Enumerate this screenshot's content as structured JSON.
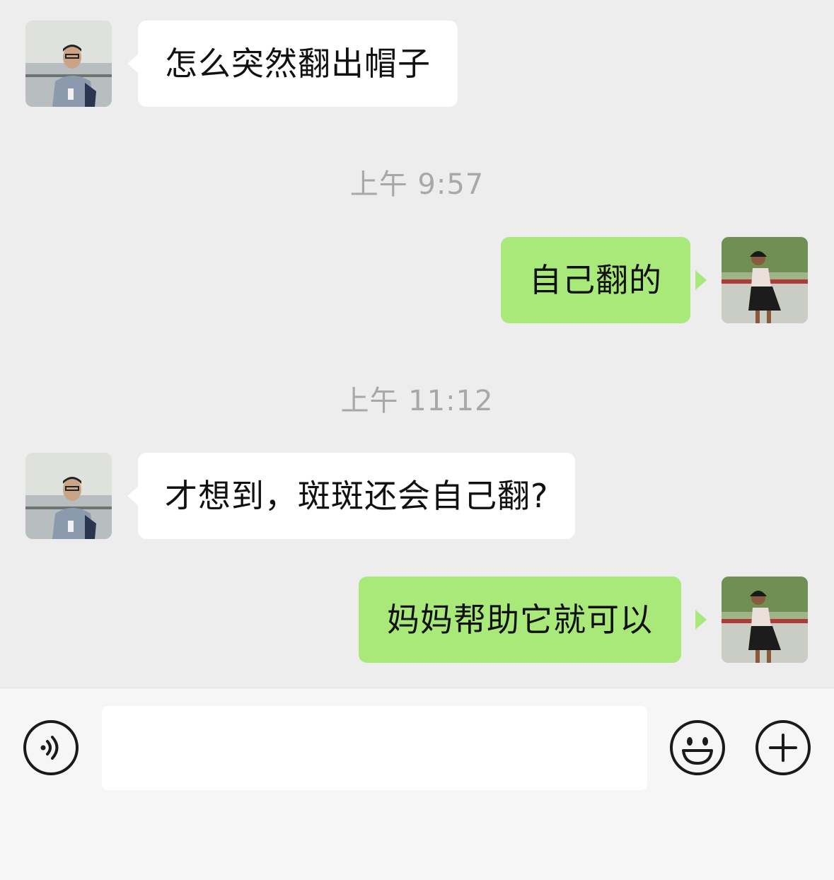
{
  "messages": [
    {
      "side": "left",
      "text": "怎么突然翻出帽子"
    },
    {
      "side": "right",
      "text": "自己翻的"
    },
    {
      "side": "left",
      "text": "才想到，斑斑还会自己翻?"
    },
    {
      "side": "right",
      "text": "妈妈帮助它就可以"
    }
  ],
  "timestamps": [
    "上午 9:57",
    "上午 11:12"
  ],
  "input_bar": {
    "placeholder": "",
    "voice_icon": "voice-icon",
    "emoji_icon": "emoji-icon",
    "plus_icon": "plus-icon"
  },
  "colors": {
    "background": "#ededed",
    "sent_bubble": "#a9e97a",
    "received_bubble": "#ffffff",
    "timestamp": "#a8a8a8"
  }
}
